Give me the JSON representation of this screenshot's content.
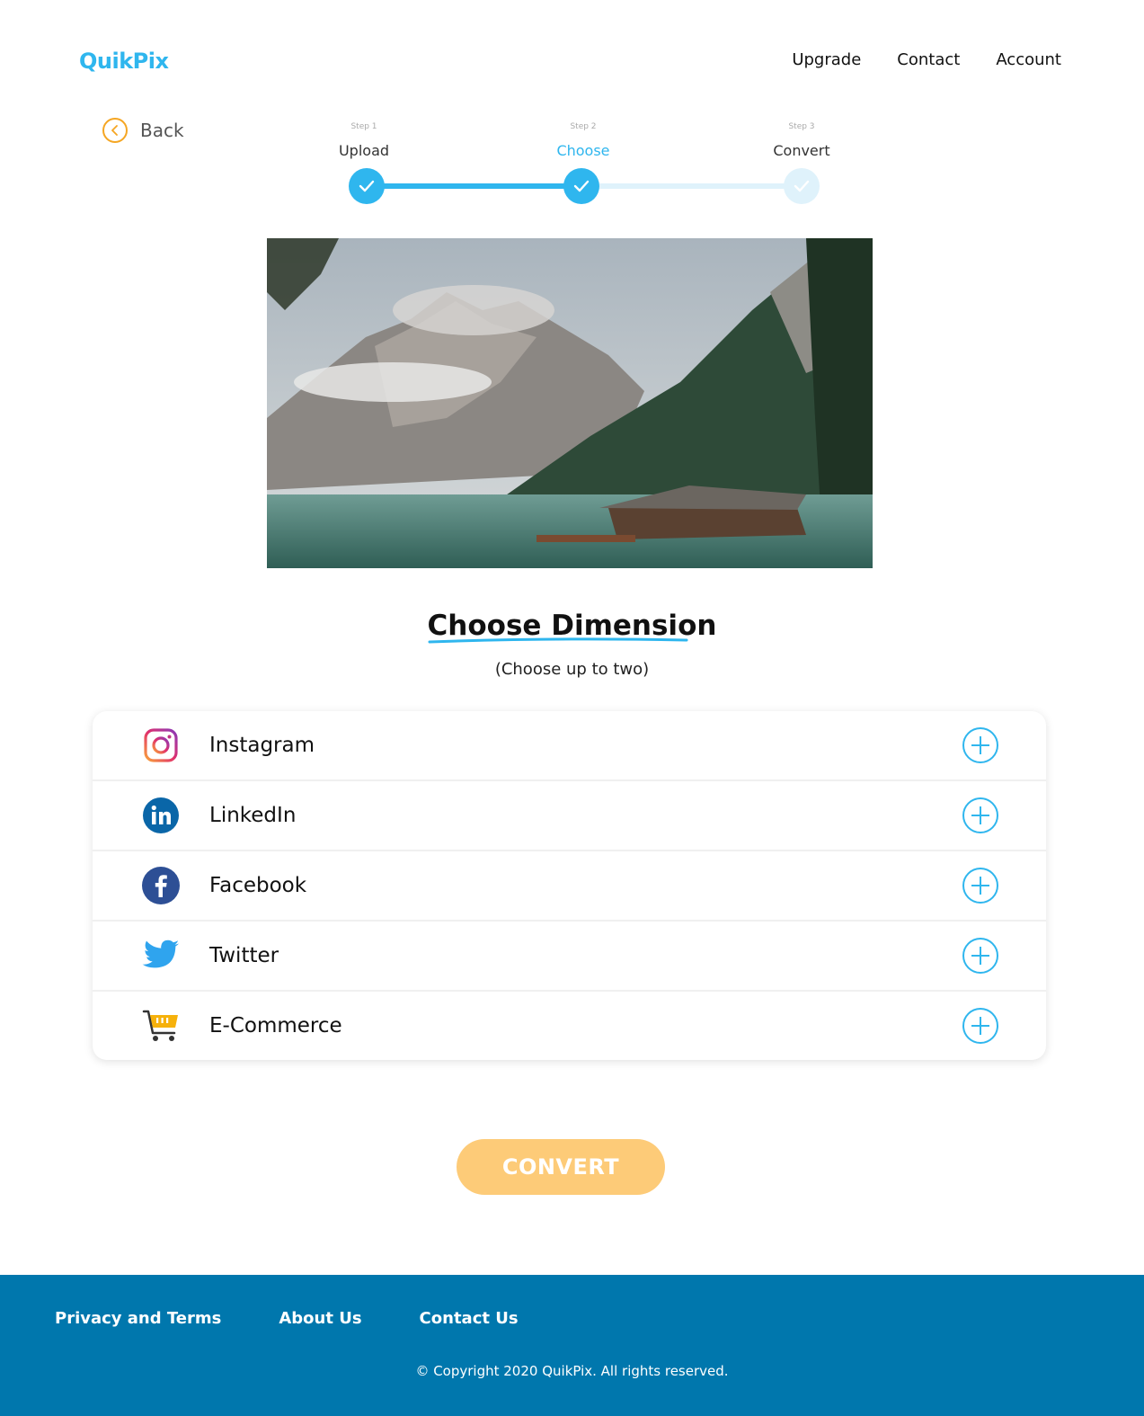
{
  "brand": {
    "logo": "QuikPix"
  },
  "nav": {
    "items": [
      "Upgrade",
      "Contact",
      "Account"
    ]
  },
  "back": {
    "label": "Back"
  },
  "steps": [
    {
      "num": "Step 1",
      "name": "Upload",
      "state": "done"
    },
    {
      "num": "Step 2",
      "name": "Choose",
      "state": "active"
    },
    {
      "num": "Step 3",
      "name": "Convert",
      "state": "pending"
    }
  ],
  "main": {
    "title": "Choose Dimension",
    "subtitle": "(Choose up to two)",
    "options": [
      {
        "label": "Instagram",
        "icon": "instagram-icon"
      },
      {
        "label": "LinkedIn",
        "icon": "linkedin-icon"
      },
      {
        "label": "Facebook",
        "icon": "facebook-icon"
      },
      {
        "label": "Twitter",
        "icon": "twitter-icon"
      },
      {
        "label": "E-Commerce",
        "icon": "shopping-cart-icon"
      }
    ],
    "convert_label": "CONVERT"
  },
  "footer": {
    "links": [
      "Privacy and Terms",
      "About Us",
      "Contact Us"
    ],
    "copyright": "© Copyright 2020 QuikPix. All rights reserved."
  },
  "colors": {
    "accent": "#2fb6ee",
    "orange": "#f5a623",
    "button": "#fdcb78",
    "footer": "#0077ad"
  }
}
